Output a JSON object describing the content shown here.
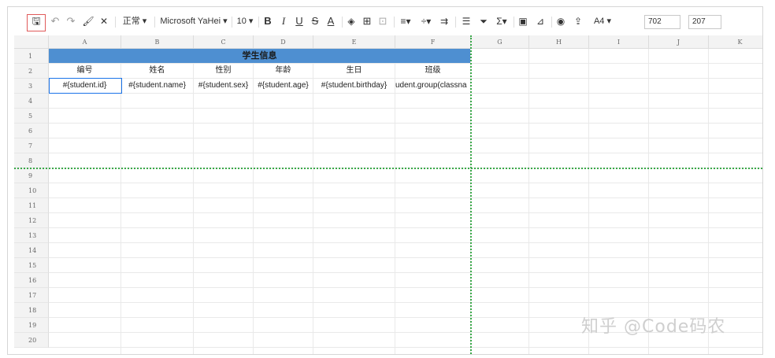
{
  "toolbar": {
    "format": "正常 ▾",
    "font": "Microsoft YaHei ▾",
    "size": "10 ▾",
    "paper": "A4 ▾",
    "width_value": "702",
    "height_value": "207"
  },
  "columns": [
    "A",
    "B",
    "C",
    "D",
    "E",
    "F",
    "G",
    "H",
    "I",
    "J",
    "K"
  ],
  "rows": [
    "1",
    "2",
    "3",
    "4",
    "5",
    "6",
    "7",
    "8",
    "9",
    "10",
    "11",
    "12",
    "13",
    "14",
    "15",
    "16",
    "17",
    "18",
    "19",
    "20"
  ],
  "sheet": {
    "title": "学生信息",
    "headers": [
      "编号",
      "姓名",
      "性别",
      "年龄",
      "生日",
      "班级"
    ],
    "expressions": [
      "#{student.id}",
      "#{student.name}",
      "#{student.sex}",
      "#{student.age}",
      "#{student.birthday}",
      "udent.group(classna"
    ]
  },
  "watermark": "知乎 @Code码农",
  "colors": {
    "title_fill": "#4e8fd1",
    "freeze": "#3aa849",
    "selection": "#1a73e8"
  }
}
